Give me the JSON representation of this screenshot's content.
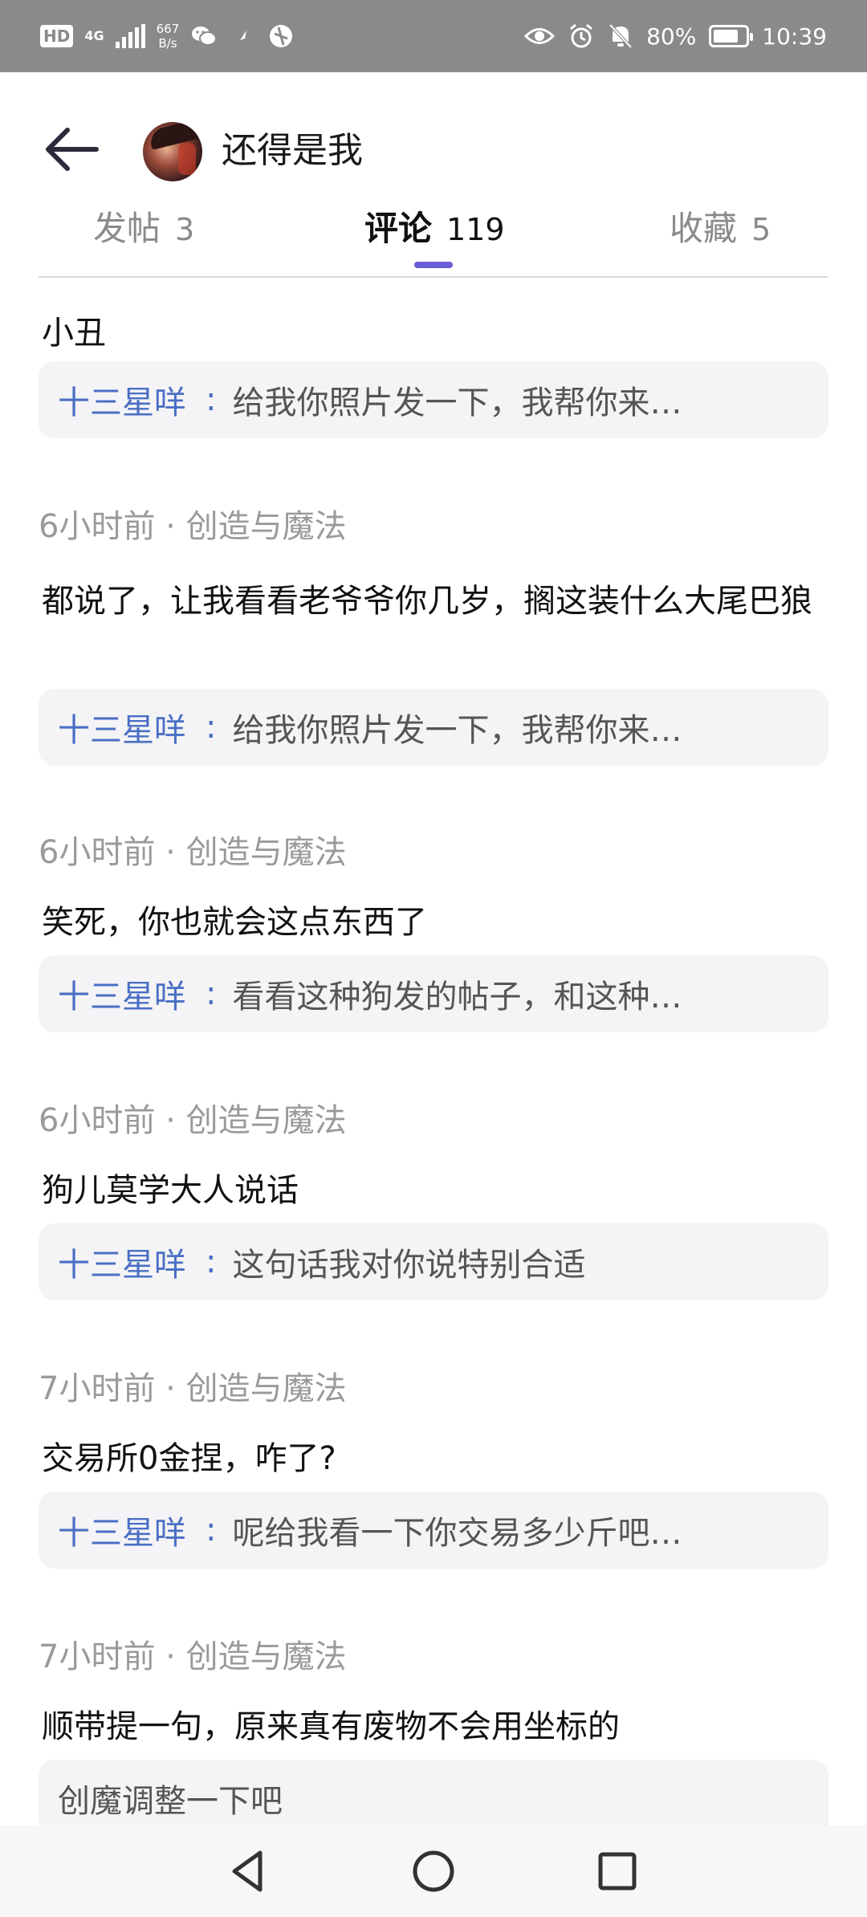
{
  "status_bar": {
    "network_badge": "HD",
    "network_type": "4G",
    "speed_value": "667",
    "speed_unit": "B/s",
    "battery_percent": "80%",
    "battery_level": 0.8,
    "time": "10:39",
    "icons": [
      "wechat-icon",
      "app-icon",
      "app-icon",
      "eye-icon",
      "alarm-icon",
      "mute-bell-icon"
    ]
  },
  "header": {
    "username": "还得是我",
    "back_icon": "arrow-left-icon"
  },
  "tabs": [
    {
      "label": "发帖",
      "count": "3",
      "active": false
    },
    {
      "label": "评论",
      "count": "119",
      "active": true
    },
    {
      "label": "收藏",
      "count": "5",
      "active": false
    }
  ],
  "accent_color": "#6a5cd6",
  "reply_name_color": "#4a6fc4",
  "feed": {
    "top_partial": {
      "body": "小丑",
      "reply_user": "十三星咩",
      "reply_sep": ":",
      "reply_text": "给我你照片发一下，我帮你来…"
    },
    "comments": [
      {
        "time": "6小时前",
        "dot": "·",
        "board": "创造与魔法",
        "body": "都说了，让我看看老爷爷你几岁，搁这装什么大尾巴狼",
        "reply_user": "十三星咩",
        "reply_sep": ":",
        "reply_text": "给我你照片发一下，我帮你来…"
      },
      {
        "time": "6小时前",
        "dot": "·",
        "board": "创造与魔法",
        "body": "笑死，你也就会这点东西了",
        "reply_user": "十三星咩",
        "reply_sep": ":",
        "reply_text": "看看这种狗发的帖子，和这种…"
      },
      {
        "time": "6小时前",
        "dot": "·",
        "board": "创造与魔法",
        "body": "狗儿莫学大人说话",
        "reply_user": "十三星咩",
        "reply_sep": ":",
        "reply_text": "这句话我对你说特别合适"
      },
      {
        "time": "7小时前",
        "dot": "·",
        "board": "创造与魔法",
        "body": "交易所0金捏，咋了?",
        "reply_user": "十三星咩",
        "reply_sep": ":",
        "reply_text": "呢给我看一下你交易多少斤吧…"
      },
      {
        "time": "7小时前",
        "dot": "·",
        "board": "创造与魔法",
        "body": "顺带提一句，原来真有废物不会用坐标的",
        "quote_text": "创魔调整一下吧"
      }
    ]
  },
  "nav": {
    "back": "nav-back-icon",
    "home": "nav-home-icon",
    "recents": "nav-recents-icon"
  }
}
